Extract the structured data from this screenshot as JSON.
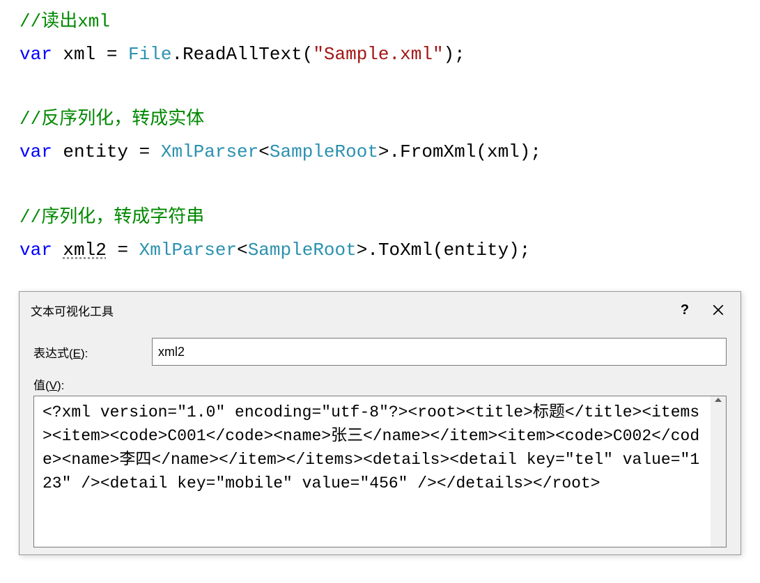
{
  "code": {
    "comment1": "//读出xml",
    "line2_var": "var",
    "line2_name": " xml = ",
    "line2_type": "File",
    "line2_dot": ".",
    "line2_method": "ReadAllText",
    "line2_paren": "(",
    "line2_string": "\"Sample.xml\"",
    "line2_end": ");",
    "comment2": "//反序列化，转成实体",
    "line4_var": "var",
    "line4_name": " entity = ",
    "line4_type1": "XmlParser",
    "line4_angle1": "<",
    "line4_type2": "SampleRoot",
    "line4_angle2": ">",
    "line4_dot": ".",
    "line4_method": "FromXml",
    "line4_paren": "(xml);",
    "comment3": "//序列化，转成字符串",
    "line6_var": "var",
    "line6_space": " ",
    "line6_varname": "xml2",
    "line6_eq": " = ",
    "line6_type1": "XmlParser",
    "line6_angle1": "<",
    "line6_type2": "SampleRoot",
    "line6_angle2": ">",
    "line6_dot": ".",
    "line6_method": "ToXml",
    "line6_paren": "(entity);"
  },
  "dialog": {
    "title": "文本可视化工具",
    "help_symbol": "?",
    "expression_label_prefix": "表达式(",
    "expression_label_hotkey": "E",
    "expression_label_suffix": "):",
    "expression_value": "xml2",
    "value_label_prefix": "值(",
    "value_label_hotkey": "V",
    "value_label_suffix": "):",
    "value_content": "<?xml version=\"1.0\" encoding=\"utf-8\"?><root><title>标题</title><items><item><code>C001</code><name>张三</name></item><item><code>C002</code><name>李四</name></item></items><details><detail key=\"tel\" value=\"123\" /><detail key=\"mobile\" value=\"456\" /></details></root>"
  }
}
